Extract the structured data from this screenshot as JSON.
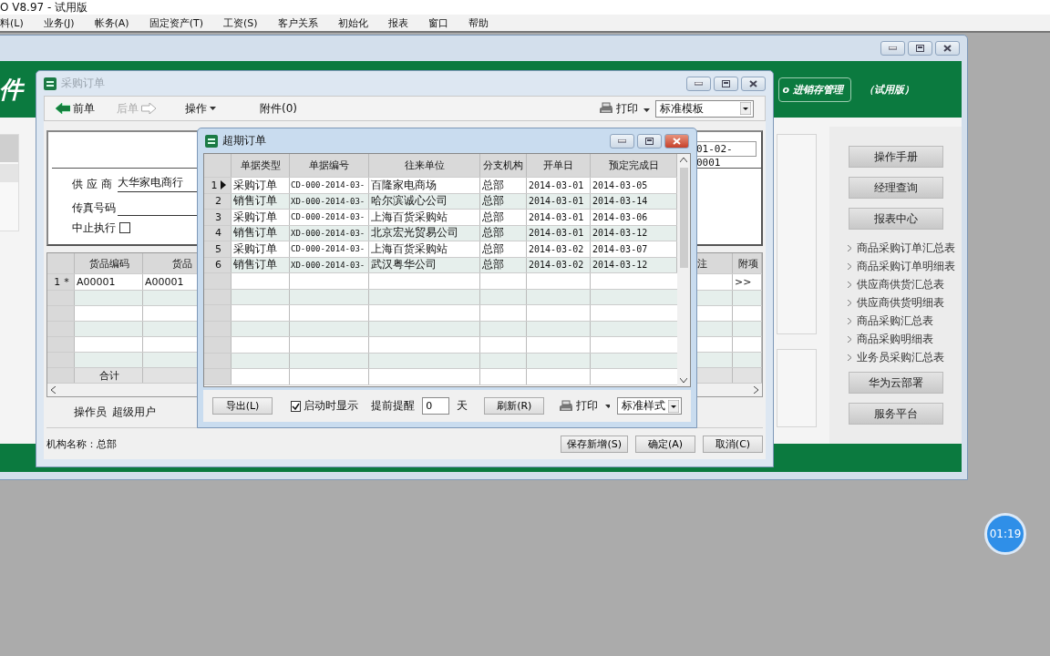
{
  "app_title": "O V8.97 - 试用版",
  "menu": [
    {
      "label": "料(L)"
    },
    {
      "label": "业务(J)"
    },
    {
      "label": "帐务(A)"
    },
    {
      "label": "固定资产(T)"
    },
    {
      "label": "工资(S)"
    },
    {
      "label": "客户关系"
    },
    {
      "label": "初始化"
    },
    {
      "label": "报表"
    },
    {
      "label": "窗口"
    },
    {
      "label": "帮助"
    }
  ],
  "main_window": {
    "logo": "件",
    "product": "o 进销存管理",
    "edition": "（试用版）",
    "side_buttons_top": [
      "操作手册",
      "经理查询",
      "报表中心"
    ],
    "report_links": [
      "商品采购订单汇总表",
      "商品采购订单明细表",
      "供应商供货汇总表",
      "供应商供货明细表",
      "商品采购汇总表",
      "商品采购明细表",
      "业务员采购汇总表"
    ],
    "side_buttons_bottom": [
      "华为云部署",
      "服务平台"
    ]
  },
  "purchase_order": {
    "title": "采购订单",
    "active": false,
    "toolbar": [
      {
        "kind": "back",
        "label": "前单",
        "disabled": false
      },
      {
        "kind": "forward",
        "label": "后单",
        "disabled": true
      },
      {
        "kind": "menu",
        "label": "操作",
        "disabled": false
      },
      {
        "kind": "plain",
        "label": "附件(0)",
        "disabled": false
      }
    ],
    "print": "打印",
    "template": "标准模板",
    "number": "01-02-0001",
    "supplier_label": "供 应 商",
    "supplier": "大华家电商行",
    "fax_label": "传真号码",
    "halt_label": "中止执行",
    "halt_checked": false,
    "columns": [
      "货品编码",
      "货品",
      "注",
      "附项"
    ],
    "rows": [
      {
        "number": "1",
        "marker": "*",
        "code": "A00001",
        "name": "A00001",
        "extra": ">>"
      }
    ],
    "total_label": "合计",
    "operator_label": "操作员",
    "operator": "超级用户",
    "org": "机构名称：总部",
    "buttons": [
      "保存新增(S)",
      "确定(A)",
      "取消(C)"
    ]
  },
  "overdue_dialog": {
    "title": "超期订单",
    "active": true,
    "columns": [
      "单据类型",
      "单据编号",
      "往来单位",
      "分支机构",
      "开单日",
      "预定完成日"
    ],
    "rows": [
      {
        "number": "1",
        "selected": true,
        "cells": [
          "采购订单",
          "CD-000-2014-03-",
          "百隆家电商场",
          "总部",
          "2014-03-01",
          "2014-03-05"
        ]
      },
      {
        "number": "2",
        "selected": false,
        "cells": [
          "销售订单",
          "XD-000-2014-03-",
          "哈尔滨诚心公司",
          "总部",
          "2014-03-01",
          "2014-03-14"
        ]
      },
      {
        "number": "3",
        "selected": false,
        "cells": [
          "采购订单",
          "CD-000-2014-03-",
          "上海百货采购站",
          "总部",
          "2014-03-01",
          "2014-03-06"
        ]
      },
      {
        "number": "4",
        "selected": false,
        "cells": [
          "销售订单",
          "XD-000-2014-03-",
          "北京宏光贸易公司",
          "总部",
          "2014-03-01",
          "2014-03-12"
        ]
      },
      {
        "number": "5",
        "selected": false,
        "cells": [
          "采购订单",
          "CD-000-2014-03-",
          "上海百货采购站",
          "总部",
          "2014-03-02",
          "2014-03-07"
        ]
      },
      {
        "number": "6",
        "selected": false,
        "cells": [
          "销售订单",
          "XD-000-2014-03-",
          "武汉粤华公司",
          "总部",
          "2014-03-02",
          "2014-03-12"
        ]
      }
    ],
    "export": "导出(L)",
    "show_on_start_label": "启动时显示",
    "show_on_start_checked": true,
    "remind_label": "提前提醒",
    "remind_days": "0",
    "days_unit": "天",
    "refresh": "刷新(R)",
    "print": "打印",
    "style": "标准样式"
  },
  "timer": "01:19"
}
